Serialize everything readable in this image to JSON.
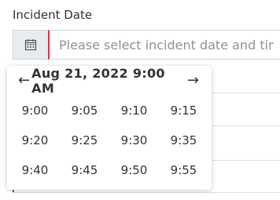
{
  "field": {
    "label": "Incident Date",
    "placeholder": "Please select incident date and time",
    "icon": "calendar-icon"
  },
  "picker": {
    "title": "Aug 21, 2022 9:00 AM",
    "prev_arrow": "←",
    "next_arrow": "→",
    "times": [
      "9:00",
      "9:05",
      "9:10",
      "9:15",
      "9:20",
      "9:25",
      "9:30",
      "9:35",
      "9:40",
      "9:45",
      "9:50",
      "9:55"
    ]
  },
  "colors": {
    "invalid_border": "#dc3545",
    "addon_bg": "#e9ecef"
  }
}
